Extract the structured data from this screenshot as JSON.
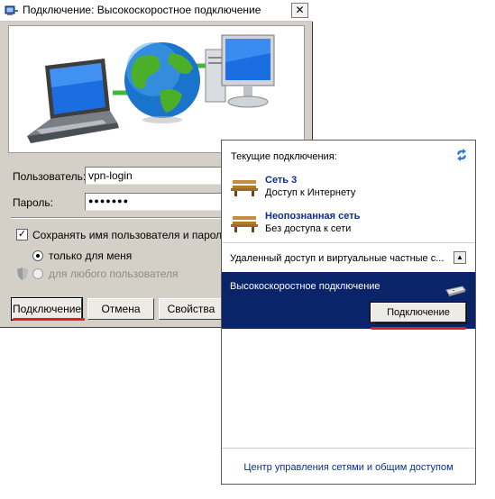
{
  "dialog": {
    "title": "Подключение: Высокоскоростное подключение",
    "close_glyph": "✕",
    "username_label": "Пользователь:",
    "username_value": "vpn-login",
    "password_label": "Пароль:",
    "password_value": "●●●●●●●",
    "save_checkbox": {
      "label": "Сохранять имя пользователя и пароль:",
      "checked": true,
      "mark": "✓"
    },
    "radio_me": {
      "label": "только для меня",
      "selected": true
    },
    "radio_any": {
      "label": "для любого пользователя",
      "enabled": false
    },
    "buttons": {
      "connect": "Подключение",
      "cancel": "Отмена",
      "properties": "Свойства"
    }
  },
  "flyout": {
    "heading": "Текущие подключения:",
    "networks": [
      {
        "name": "Сеть  3",
        "status": "Доступ к Интернету"
      },
      {
        "name": "Неопознанная сеть",
        "status": "Без доступа к сети"
      }
    ],
    "vpn_section_label": "Удаленный доступ и виртуальные частные с...",
    "collapse_glyph": "▲",
    "connection": {
      "name": "Высокоскоростное подключение",
      "button": "Подключение"
    },
    "footer_link": "Центр управления сетями и общим доступом"
  },
  "colors": {
    "dialog_bg": "#d4d0c8",
    "selection_bg": "#0a246a",
    "link": "#0b2f8c",
    "highlight_underline": "#e0201c"
  },
  "icons": [
    "dialup-icon",
    "close-icon",
    "laptop-icon",
    "globe-icon",
    "desktop-pc-icon",
    "refresh-icon",
    "bench-network-icon",
    "shield-icon",
    "modem-icon"
  ]
}
